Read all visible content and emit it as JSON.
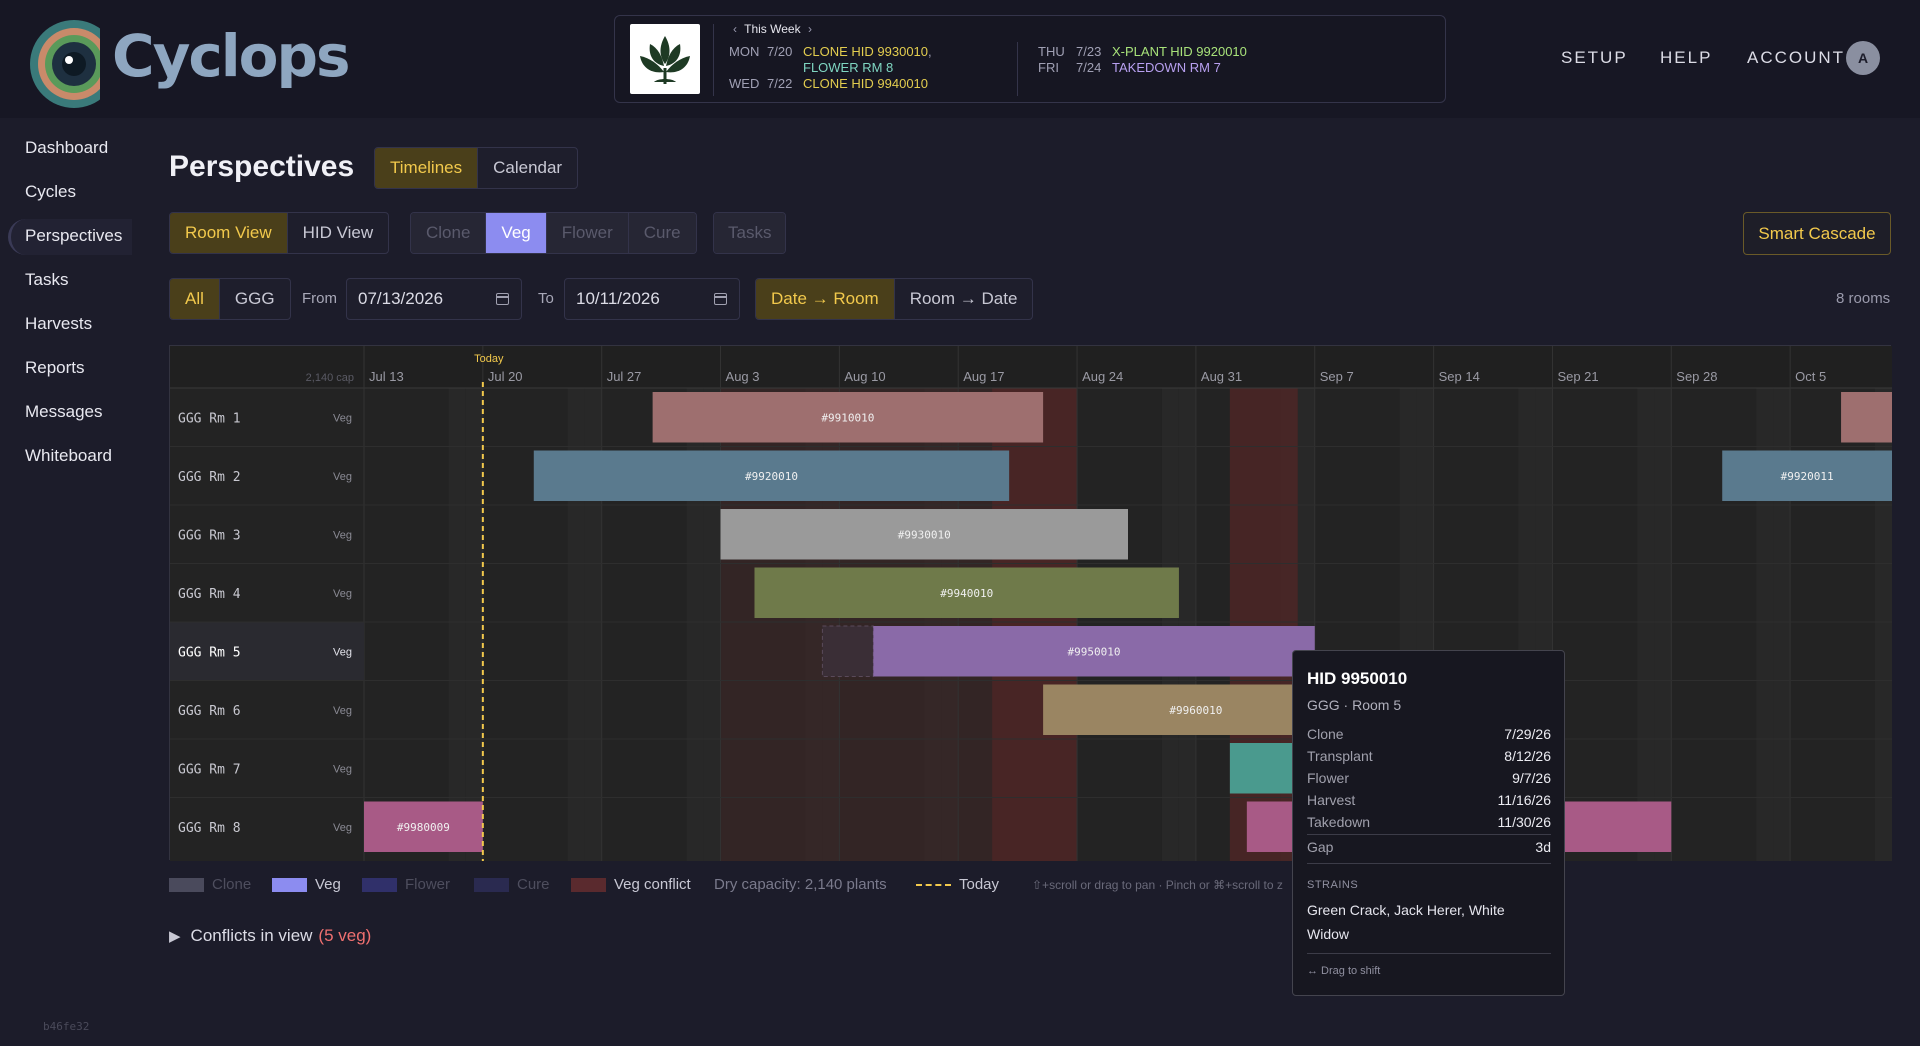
{
  "app": {
    "name": "Cyclops",
    "version": "b46fe32"
  },
  "week": {
    "label": "This Week",
    "left": [
      {
        "day": "MON",
        "date": "7/20",
        "events": [
          "CLONE HID 9930010",
          "FLOWER RM 8"
        ]
      },
      {
        "day": "WED",
        "date": "7/22",
        "events": [
          "CLONE HID 9940010"
        ]
      }
    ],
    "right": [
      {
        "day": "THU",
        "date": "7/23",
        "events": [
          "X-PLANT HID 9920010"
        ]
      },
      {
        "day": "FRI",
        "date": "7/24",
        "events": [
          "TAKEDOWN RM 7"
        ]
      }
    ]
  },
  "topnav": {
    "setup": "SETUP",
    "help": "HELP",
    "account": "ACCOUNT",
    "avatar": "A"
  },
  "sidebar": {
    "items": [
      {
        "label": "Dashboard"
      },
      {
        "label": "Cycles"
      },
      {
        "label": "Perspectives"
      },
      {
        "label": "Tasks"
      },
      {
        "label": "Harvests"
      },
      {
        "label": "Reports"
      },
      {
        "label": "Messages"
      },
      {
        "label": "Whiteboard"
      }
    ],
    "active": "Perspectives"
  },
  "page": {
    "title": "Perspectives"
  },
  "perspective_tabs": {
    "timelines": "Timelines",
    "calendar": "Calendar",
    "active": "Timelines"
  },
  "view_toggle": {
    "room": "Room View",
    "hid": "HID View",
    "active": "Room View"
  },
  "stage_filter": {
    "clone": "Clone",
    "veg": "Veg",
    "flower": "Flower",
    "cure": "Cure",
    "active": "Veg"
  },
  "tasks_btn": "Tasks",
  "smart_cascade": "Smart Cascade",
  "facility_filter": {
    "all": "All",
    "ggg": "GGG",
    "active": "All"
  },
  "range": {
    "from_label": "From",
    "from": "07/13/2026",
    "to_label": "To",
    "to": "10/11/2026"
  },
  "sort_toggle": {
    "date_room": "Date → Room",
    "room_date": "Room → Date",
    "active": "Date → Room"
  },
  "rooms_count": "8 rooms",
  "chart_data": {
    "type": "gantt",
    "cap_label": "2,140 cap",
    "today_label": "Today",
    "range_start": "2026-07-13",
    "range_end": "2026-10-11",
    "today": "2026-07-20",
    "week_ticks": [
      "Jul 13",
      "Jul 20",
      "Jul 27",
      "Aug 3",
      "Aug 10",
      "Aug 17",
      "Aug 24",
      "Aug 31",
      "Sep 7",
      "Sep 14",
      "Sep 21",
      "Sep 28",
      "Oct 5"
    ],
    "conflict_spans": [
      {
        "start": "2026-08-03",
        "end": "2026-08-24",
        "shade": "light"
      },
      {
        "start": "2026-08-19",
        "end": "2026-08-24",
        "shade": "dark"
      },
      {
        "start": "2026-09-02",
        "end": "2026-09-06",
        "shade": "dark"
      }
    ],
    "rooms": [
      {
        "name": "GGG Rm 1",
        "stage": "Veg",
        "bars": [
          {
            "label": "#9910010",
            "start": "2026-07-30",
            "end": "2026-08-22",
            "color": "#9e6f6f"
          },
          {
            "label": "",
            "start": "2026-10-08",
            "end": "2026-10-11",
            "color": "#9e6f6f"
          }
        ]
      },
      {
        "name": "GGG Rm 2",
        "stage": "Veg",
        "bars": [
          {
            "label": "#9920010",
            "start": "2026-07-23",
            "end": "2026-08-20",
            "color": "#5a7a8e"
          },
          {
            "label": "#9920011",
            "start": "2026-10-01",
            "end": "2026-10-11",
            "color": "#5a7a8e"
          }
        ]
      },
      {
        "name": "GGG Rm 3",
        "stage": "Veg",
        "bars": [
          {
            "label": "#9930010",
            "start": "2026-08-03",
            "end": "2026-08-27",
            "color": "#9a9a9a"
          }
        ]
      },
      {
        "name": "GGG Rm 4",
        "stage": "Veg",
        "bars": [
          {
            "label": "#9940010",
            "start": "2026-08-05",
            "end": "2026-08-30",
            "color": "#6f7a4a"
          }
        ]
      },
      {
        "name": "GGG Rm 5",
        "stage": "Veg",
        "highlight": true,
        "bars": [
          {
            "label": "#9950010",
            "start": "2026-08-12",
            "end": "2026-09-07",
            "color": "#8a6aa8",
            "ghost_start": "2026-08-09"
          }
        ]
      },
      {
        "name": "GGG Rm 6",
        "stage": "Veg",
        "bars": [
          {
            "label": "#9960010",
            "start": "2026-08-22",
            "end": "2026-09-09",
            "color": "#9a8562"
          }
        ]
      },
      {
        "name": "GGG Rm 7",
        "stage": "Veg",
        "bars": [
          {
            "label": "",
            "start": "2026-09-02",
            "end": "2026-09-20",
            "color": "#4a9a8e"
          }
        ]
      },
      {
        "name": "GGG Rm 8",
        "stage": "Veg",
        "bars": [
          {
            "label": "#9980009",
            "start": "2026-07-13",
            "end": "2026-07-20",
            "color": "#a85a86"
          },
          {
            "label": "",
            "start": "2026-09-03",
            "end": "2026-09-28",
            "color": "#a85a86"
          }
        ]
      }
    ]
  },
  "legend": {
    "clone": "Clone",
    "veg": "Veg",
    "flower": "Flower",
    "cure": "Cure",
    "conflict": "Veg conflict",
    "capacity": "Dry capacity: 2,140 plants",
    "today": "Today",
    "hint": "⇧+scroll or drag to pan · Pinch or ⌘+scroll to z"
  },
  "conflicts": {
    "label": "Conflicts in view",
    "count": "(5 veg)"
  },
  "tooltip": {
    "title": "HID 9950010",
    "sub": "GGG · Room 5",
    "rows": [
      {
        "k": "Clone",
        "v": "7/29/26"
      },
      {
        "k": "Transplant",
        "v": "8/12/26"
      },
      {
        "k": "Flower",
        "v": "9/7/26"
      },
      {
        "k": "Harvest",
        "v": "11/16/26"
      },
      {
        "k": "Takedown",
        "v": "11/30/26"
      }
    ],
    "gap_k": "Gap",
    "gap_v": "3d",
    "strains_h": "STRAINS",
    "strains": "Green Crack, Jack Herer, White Widow",
    "drag": "↔ Drag to shift"
  },
  "colors": {
    "accent": "#f2c94c",
    "veg": "#8c8cf0",
    "conflict": "#6e2a2a",
    "bg": "#1c1c2a"
  }
}
